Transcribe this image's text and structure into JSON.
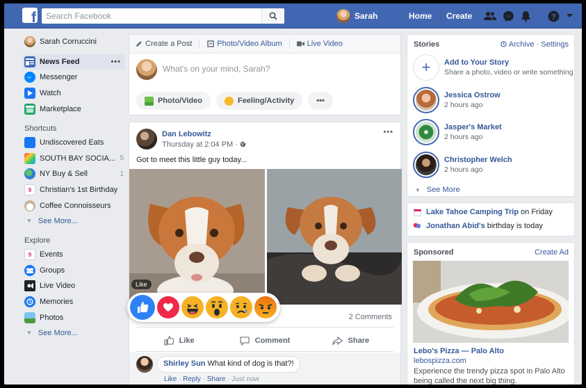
{
  "topbar": {
    "search_placeholder": "Search Facebook",
    "user_name": "Sarah",
    "home_label": "Home",
    "create_label": "Create"
  },
  "leftnav": {
    "profile_name": "Sarah Corruccini",
    "main": [
      {
        "label": "News Feed",
        "icon": "news-feed-icon"
      },
      {
        "label": "Messenger",
        "icon": "messenger-icon"
      },
      {
        "label": "Watch",
        "icon": "watch-icon"
      },
      {
        "label": "Marketplace",
        "icon": "marketplace-icon"
      }
    ],
    "more_dots": "•••",
    "shortcuts_heading": "Shortcuts",
    "shortcuts": [
      {
        "label": "Undiscovered Eats",
        "count": ""
      },
      {
        "label": "SOUTH BAY SOCIA...",
        "count": "5"
      },
      {
        "label": "NY Buy & Sell",
        "count": "1"
      },
      {
        "label": "Christian's 1st Birthday",
        "count": ""
      },
      {
        "label": "Coffee Connoisseurs",
        "count": ""
      }
    ],
    "see_more": "See More...",
    "explore_heading": "Explore",
    "explore": [
      {
        "label": "Events"
      },
      {
        "label": "Groups"
      },
      {
        "label": "Live Video"
      },
      {
        "label": "Memories"
      },
      {
        "label": "Photos"
      }
    ],
    "explore_see_more": "See More..."
  },
  "composer": {
    "tabs": [
      "Create a Post",
      "Photo/Video Album",
      "Live Video"
    ],
    "placeholder": "What's on your mind, Sarah?",
    "actions": [
      "Photo/Video",
      "Feeling/Activity"
    ],
    "more": "•••"
  },
  "post": {
    "author": "Dan Lebowitz",
    "time": "Thursday at 2:04 PM · ",
    "menu": "•••",
    "text": "Got to meet this little guy today...",
    "tooltip": "Like",
    "comments_count": "2 Comments",
    "actions": [
      "Like",
      "Comment",
      "Share"
    ],
    "comment": {
      "author": "Shirley Sun",
      "text": "What kind of dog is that?!",
      "like": "Like",
      "reply": "Reply",
      "share": "Share",
      "time": "Just now"
    }
  },
  "stories": {
    "heading": "Stories",
    "archive": "Archive",
    "settings": "Settings",
    "add_title": "Add to Your Story",
    "add_sub": "Share a photo, video or write something",
    "items": [
      {
        "name": "Jessica Ostrow",
        "time": "2 hours ago"
      },
      {
        "name": "Jasper's Market",
        "time": "2 hours ago"
      },
      {
        "name": "Christopher Welch",
        "time": "2 hours ago"
      }
    ],
    "see_more": "See More"
  },
  "events": {
    "event_name": "Lake Tahoe Camping Trip",
    "event_when": "on Friday",
    "birthday_name": "Jonathan Abid's",
    "birthday_text": "birthday is today"
  },
  "sponsored": {
    "heading": "Sponsored",
    "create_ad": "Create Ad",
    "title": "Lebo's Pizza — Palo Alto",
    "url": "lebospizza.com",
    "desc": "Experience the trendy pizza spot in Palo Alto being called the next big thing."
  },
  "colors": {
    "brand": "#4267b2",
    "link": "#365899",
    "background": "#e9ebee"
  }
}
